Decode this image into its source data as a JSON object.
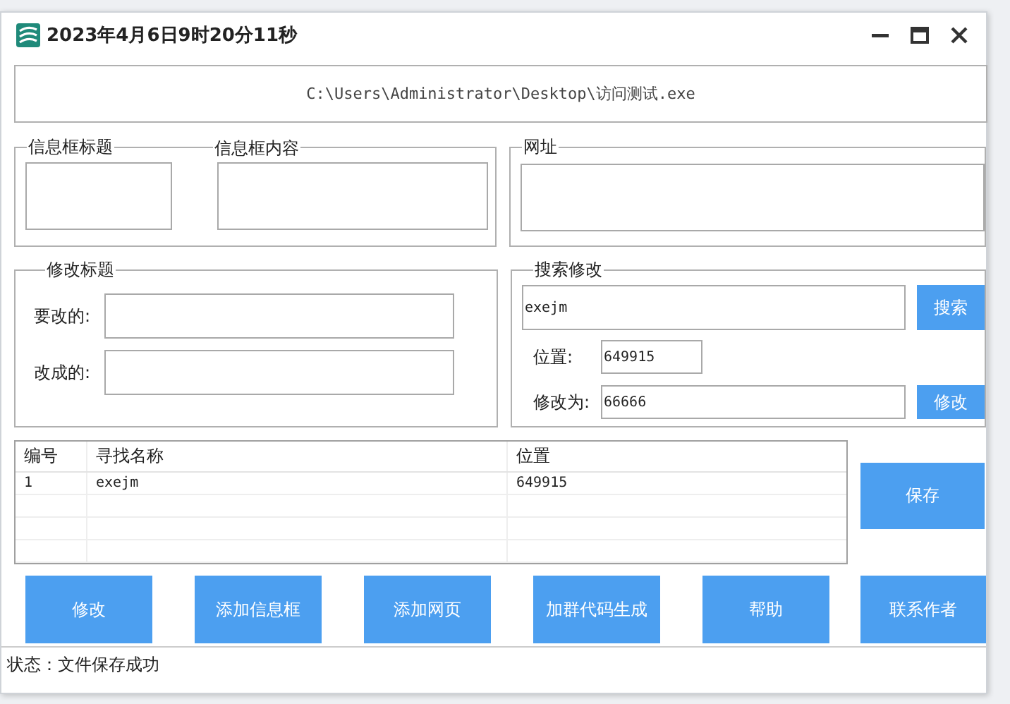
{
  "window": {
    "title": "2023年4月6日9时20分11秒"
  },
  "path": "C:\\Users\\Administrator\\Desktop\\访问测试.exe",
  "info_title": {
    "label": "信息框标题"
  },
  "info_content": {
    "label": "信息框内容"
  },
  "url": {
    "label": "网址"
  },
  "modify_title": {
    "label": "修改标题",
    "fields": [
      {
        "label": "要改的:"
      },
      {
        "label": "改成的:"
      }
    ]
  },
  "search_modify": {
    "label": "搜索修改",
    "search_value": "exejm",
    "search_button": "搜索",
    "position_label": "位置:",
    "position_value": "649915",
    "modify_label": "修改为:",
    "modify_value": "66666",
    "modify_button": "修改"
  },
  "table": {
    "columns": [
      "编号",
      "寻找名称",
      "位置"
    ],
    "rows": [
      [
        "1",
        "exejm",
        "649915"
      ]
    ]
  },
  "save_button": "保存",
  "buttons": [
    "修改",
    "添加信息框",
    "添加网页",
    "加群代码生成",
    "帮助",
    "联系作者"
  ],
  "status": "状态：文件保存成功"
}
